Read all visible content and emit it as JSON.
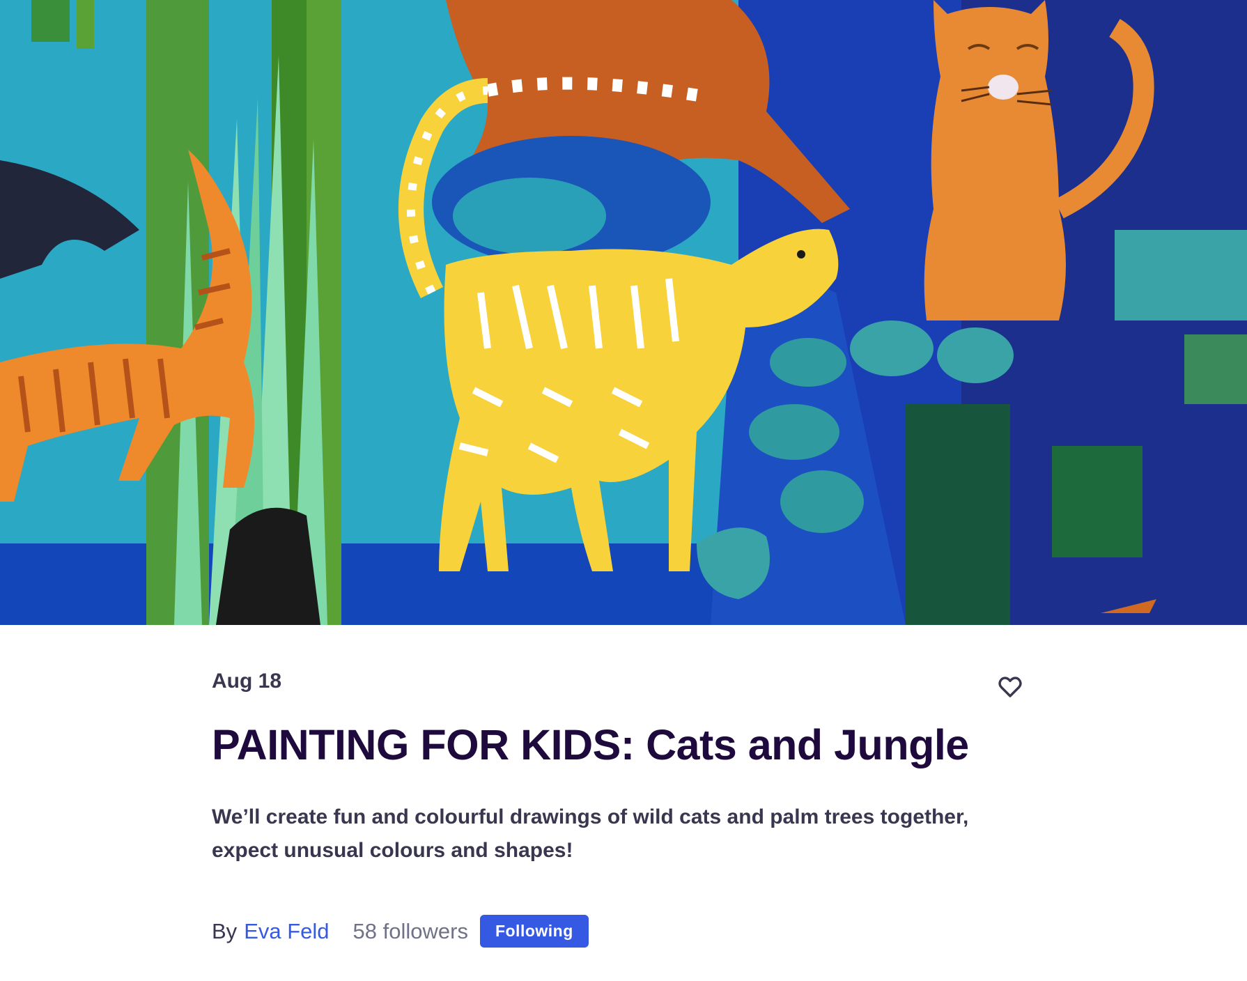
{
  "hero": {
    "image_description_icon": "painting-cats-jungle-image"
  },
  "event": {
    "date": "Aug 18",
    "title": "PAINTING FOR KIDS: Cats and Jungle",
    "summary": "We’ll create fun and colourful drawings of wild cats and palm trees together, expect unusual colours and shapes!",
    "like_icon": "heart-outline-icon"
  },
  "organizer": {
    "by_label": "By",
    "name": "Eva Feld",
    "followers": "58 followers",
    "follow_button_label": "Following"
  },
  "colors": {
    "title": "#1e0a3c",
    "text": "#39364f",
    "muted": "#6f7287",
    "accent": "#3659e3"
  }
}
